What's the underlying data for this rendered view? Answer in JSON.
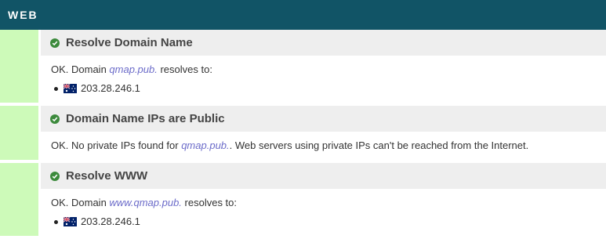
{
  "header": {
    "title": "WEB"
  },
  "checks": [
    {
      "title": "Resolve Domain Name",
      "status": "ok",
      "text_prefix": "OK. Domain ",
      "domain": "qmap.pub.",
      "text_suffix": " resolves to:",
      "ips": [
        {
          "flag": "au-flag-icon",
          "ip": "203.28.246.1"
        }
      ]
    },
    {
      "title": "Domain Name IPs are Public",
      "status": "ok",
      "text_prefix": "OK. No private IPs found for ",
      "domain": "qmap.pub.",
      "text_suffix": ". Web servers using private IPs can't be reached from the Internet."
    },
    {
      "title": "Resolve WWW",
      "status": "ok",
      "text_prefix": "OK. Domain ",
      "domain": "www.qmap.pub.",
      "text_suffix": " resolves to:",
      "ips": [
        {
          "flag": "au-flag-icon",
          "ip": "203.28.246.1"
        }
      ]
    }
  ],
  "colors": {
    "header_bg": "#115466",
    "status_bar_ok": "#cdfab9",
    "check_icon": "#3c8a3c",
    "link": "#6b6bc9"
  }
}
